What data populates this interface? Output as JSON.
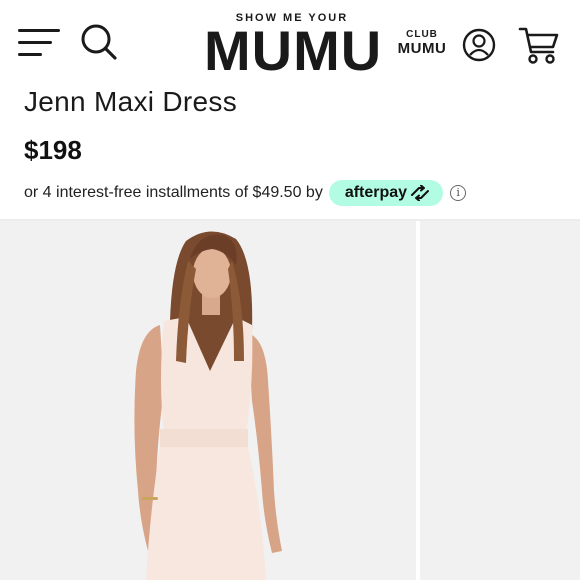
{
  "header": {
    "logo_top": "SHOW ME YOUR",
    "logo_main": "MUMU",
    "club_top": "CLUB",
    "club_main": "MUMU",
    "icons": [
      "menu-icon",
      "search-icon",
      "account-icon",
      "cart-icon"
    ]
  },
  "product": {
    "title": "Jenn Maxi Dress",
    "price": "$198"
  },
  "installments": {
    "text": "or 4 interest-free installments of $49.50 by",
    "provider": "afterpay",
    "provider_color": "#b2fce4",
    "info_glyph": "i"
  },
  "colors": {
    "text": "#1a1a1a",
    "photo_background": "#f1f1f1"
  }
}
